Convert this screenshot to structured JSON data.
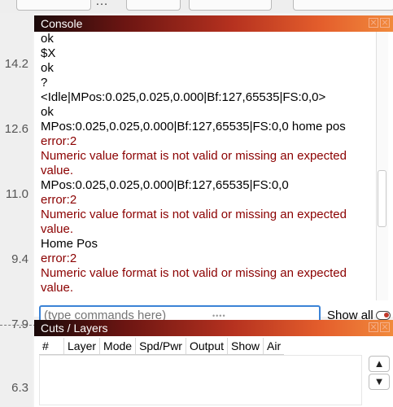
{
  "icons": {
    "top_glyph": "…"
  },
  "ruler": {
    "ticks": [
      "14.2",
      "12.6",
      "11.0",
      "9.4",
      "7.9",
      "6.3"
    ]
  },
  "console": {
    "title": "Console",
    "lines": [
      {
        "text": "ok",
        "type": "normal"
      },
      {
        "text": "$X",
        "type": "normal"
      },
      {
        "text": "ok",
        "type": "normal"
      },
      {
        "text": "?",
        "type": "normal"
      },
      {
        "text": "<Idle|MPos:0.025,0.025,0.000|Bf:127,65535|FS:0,0>",
        "type": "normal"
      },
      {
        "text": "ok",
        "type": "normal"
      },
      {
        "text": "MPos:0.025,0.025,0.000|Bf:127,65535|FS:0,0 home pos",
        "type": "normal"
      },
      {
        "text": "error:2",
        "type": "error"
      },
      {
        "text": "Numeric value format is not valid or missing an expected",
        "type": "error"
      },
      {
        "text": "value.",
        "type": "error"
      },
      {
        "text": "MPos:0.025,0.025,0.000|Bf:127,65535|FS:0,0",
        "type": "normal"
      },
      {
        "text": "error:2",
        "type": "error"
      },
      {
        "text": "Numeric value format is not valid or missing an expected",
        "type": "error"
      },
      {
        "text": "value.",
        "type": "error"
      },
      {
        "text": "Home Pos",
        "type": "normal"
      },
      {
        "text": "error:2",
        "type": "error"
      },
      {
        "text": "Numeric value format is not valid or missing an expected",
        "type": "error"
      },
      {
        "text": "value.",
        "type": "error"
      }
    ],
    "input_placeholder": "(type commands here)",
    "show_all_label": "Show all"
  },
  "cuts": {
    "title": "Cuts / Layers",
    "columns": [
      "#",
      "Layer",
      "Mode",
      "Spd/Pwr",
      "Output",
      "Show",
      "Air"
    ],
    "up_arrow": "▲",
    "down_arrow": "▼"
  },
  "colors": {
    "accent": "#3b83d6",
    "error_text": "#8b0000"
  }
}
